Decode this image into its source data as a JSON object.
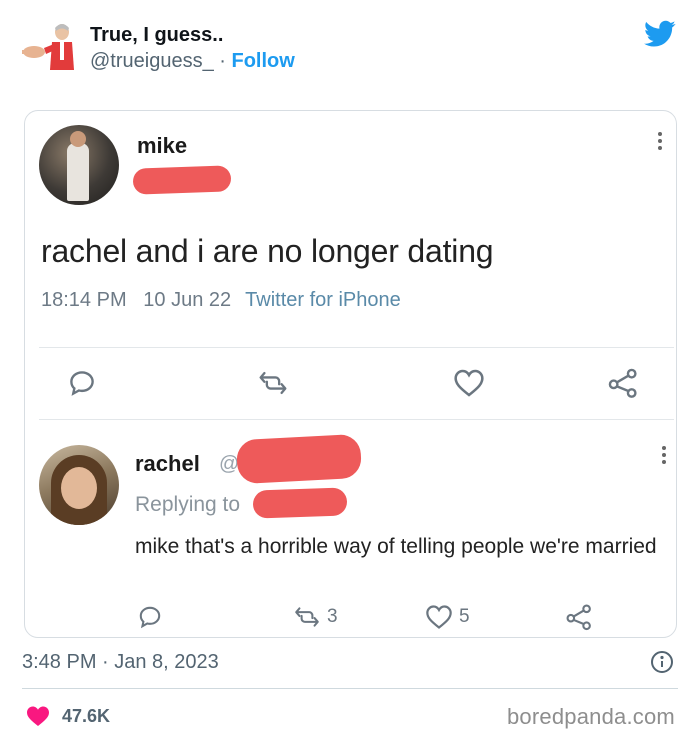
{
  "embed": {
    "author_name": "True, I guess..",
    "author_handle": "@trueiguess_",
    "separator": " · ",
    "follow_label": "Follow",
    "timestamp": "3:48 PM · Jan 8, 2023",
    "like_count": "47.6K",
    "watermark": "boredpanda.com"
  },
  "screenshot": {
    "tweet": {
      "author": "mike",
      "text": "rachel and i are no longer dating",
      "time": "18:14 PM",
      "date": "10 Jun 22",
      "source": "Twitter for iPhone"
    },
    "reply": {
      "author": "rachel",
      "handle_prefix": "@",
      "replying_to": "Replying to",
      "text": "mike that's a horrible way of telling people we're married",
      "retweets": "3",
      "likes": "5"
    }
  },
  "icons": {
    "twitter": "twitter-bird-icon",
    "reply": "comment-icon",
    "retweet": "retweet-icon",
    "like": "heart-icon",
    "share": "share-icon",
    "info": "info-icon",
    "more": "more-options-icon"
  },
  "colors": {
    "brand": "#1d9bf0",
    "like": "#f91880",
    "redaction": "#ee5a5a"
  }
}
